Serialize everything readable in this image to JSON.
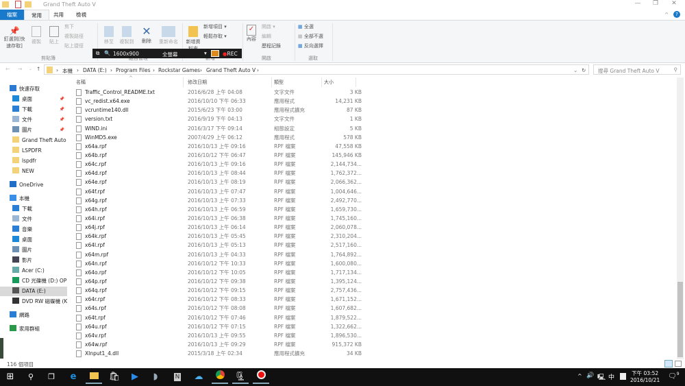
{
  "window": {
    "title": "Grand Theft Auto V",
    "minimize": "—",
    "maximize": "❐",
    "close": "✕"
  },
  "tabs": [
    {
      "label": "檔案"
    },
    {
      "label": "常用"
    },
    {
      "label": "共用"
    },
    {
      "label": "檢視"
    }
  ],
  "ribbon": {
    "clipboard": {
      "pin": "釘選到[快速存取]",
      "copy": "複製",
      "paste": "貼上",
      "cut": "剪下",
      "copy_path": "複製路徑",
      "paste_shortcut": "貼上捷徑",
      "group": "剪貼簿"
    },
    "organize": {
      "move_to": "移至",
      "copy_to": "複製到",
      "delete": "刪除",
      "rename": "重新命名",
      "group": "組合管理"
    },
    "new": {
      "new_folder": "新增資料夾",
      "new_item": "新增項目 ▾",
      "easy_access": "輕鬆存取 ▾",
      "group": "新增"
    },
    "open": {
      "properties": "內容",
      "open": "開啟 ▾",
      "edit": "編輯",
      "history": "歷程記錄",
      "group": "開啟"
    },
    "select": {
      "select_all": "全選",
      "select_none": "全部不選",
      "invert": "反向選擇",
      "group": "選取"
    }
  },
  "recorder": {
    "resolution": "1600x900",
    "mode": "全螢幕",
    "rec": "REC"
  },
  "address": {
    "crumbs": [
      "本機",
      "DATA (E:)",
      "Program Files",
      "Rockstar Games",
      "Grand Theft Auto V"
    ],
    "search_placeholder": "搜尋 Grand Theft Auto V"
  },
  "nav": [
    {
      "label": "快速存取",
      "color": "#2b79d0"
    },
    {
      "label": "桌面",
      "color": "#1e88d8",
      "pin": true
    },
    {
      "label": "下載",
      "color": "#2a7fd4",
      "pin": true
    },
    {
      "label": "文件",
      "color": "#9bb7d3",
      "pin": true
    },
    {
      "label": "圖片",
      "color": "#6d90b3",
      "pin": true
    },
    {
      "label": "Grand Theft Auto V",
      "color": "#f3d27a"
    },
    {
      "label": "LSPDFR",
      "color": "#f3d27a"
    },
    {
      "label": "lspdfr",
      "color": "#f3d27a"
    },
    {
      "label": "NEW",
      "color": "#f3d27a"
    },
    {
      "label": "OneDrive",
      "color": "#1f6fc9"
    },
    {
      "label": "本機",
      "color": "#3a8ee6"
    },
    {
      "label": "下載",
      "color": "#2a7fd4"
    },
    {
      "label": "文件",
      "color": "#9bb7d3"
    },
    {
      "label": "音樂",
      "color": "#2a7fd4"
    },
    {
      "label": "桌面",
      "color": "#1e88d8"
    },
    {
      "label": "圖片",
      "color": "#6d90b3"
    },
    {
      "label": "影片",
      "color": "#445"
    },
    {
      "label": "Acer (C:)",
      "color": "#6aa"
    },
    {
      "label": "CD 光碟機 (D:) OPE",
      "color": "#1a9a5a"
    },
    {
      "label": "DATA (E:)",
      "color": "#555",
      "selected": true
    },
    {
      "label": "DVD RW 磁碟機 (K",
      "color": "#333"
    },
    {
      "label": "網路",
      "color": "#2a7fd4"
    },
    {
      "label": "家用群組",
      "color": "#2a9a4a"
    }
  ],
  "columns": {
    "name": "名稱",
    "date": "修改日期",
    "type": "類型",
    "size": "大小"
  },
  "files": [
    [
      "Traffic_Control_README.txt",
      "2016/6/28 上午 04:08",
      "文字文件",
      "3 KB"
    ],
    [
      "vc_redist.x64.exe",
      "2016/10/10 下午 06:33",
      "應用程式",
      "14,231 KB"
    ],
    [
      "vcruntime140.dll",
      "2015/6/23 下午 03:00",
      "應用程式擴充",
      "87 KB"
    ],
    [
      "version.txt",
      "2016/9/19 下午 04:13",
      "文字文件",
      "1 KB"
    ],
    [
      "WIND.ini",
      "2016/3/17 下午 09:14",
      "組態設定",
      "5 KB"
    ],
    [
      "WinMD5.exe",
      "2007/4/29 上午 06:12",
      "應用程式",
      "578 KB"
    ],
    [
      "x64a.rpf",
      "2016/10/13 上午 09:16",
      "RPF 檔案",
      "47,558 KB"
    ],
    [
      "x64b.rpf",
      "2016/10/12 下午 06:47",
      "RPF 檔案",
      "145,946 KB"
    ],
    [
      "x64c.rpf",
      "2016/10/13 上午 09:16",
      "RPF 檔案",
      "2,144,734..."
    ],
    [
      "x64d.rpf",
      "2016/10/13 上午 08:44",
      "RPF 檔案",
      "1,762,372..."
    ],
    [
      "x64e.rpf",
      "2016/10/13 上午 08:19",
      "RPF 檔案",
      "2,066,362..."
    ],
    [
      "x64f.rpf",
      "2016/10/13 上午 07:47",
      "RPF 檔案",
      "1,004,646..."
    ],
    [
      "x64g.rpf",
      "2016/10/13 上午 07:33",
      "RPF 檔案",
      "2,492,770..."
    ],
    [
      "x64h.rpf",
      "2016/10/13 上午 06:59",
      "RPF 檔案",
      "1,659,730..."
    ],
    [
      "x64i.rpf",
      "2016/10/13 上午 06:38",
      "RPF 檔案",
      "1,745,160..."
    ],
    [
      "x64j.rpf",
      "2016/10/13 上午 06:14",
      "RPF 檔案",
      "2,060,078..."
    ],
    [
      "x64k.rpf",
      "2016/10/13 上午 05:45",
      "RPF 檔案",
      "2,310,204..."
    ],
    [
      "x64l.rpf",
      "2016/10/13 上午 05:13",
      "RPF 檔案",
      "2,517,160..."
    ],
    [
      "x64m.rpf",
      "2016/10/13 上午 04:33",
      "RPF 檔案",
      "1,764,892..."
    ],
    [
      "x64n.rpf",
      "2016/10/12 下午 10:33",
      "RPF 檔案",
      "1,600,080..."
    ],
    [
      "x64o.rpf",
      "2016/10/12 下午 10:05",
      "RPF 檔案",
      "1,717,134..."
    ],
    [
      "x64p.rpf",
      "2016/10/12 下午 09:38",
      "RPF 檔案",
      "1,395,124..."
    ],
    [
      "x64q.rpf",
      "2016/10/12 下午 09:15",
      "RPF 檔案",
      "2,757,436..."
    ],
    [
      "x64r.rpf",
      "2016/10/12 下午 08:33",
      "RPF 檔案",
      "1,671,152..."
    ],
    [
      "x64s.rpf",
      "2016/10/12 下午 08:08",
      "RPF 檔案",
      "1,607,682..."
    ],
    [
      "x64t.rpf",
      "2016/10/12 下午 07:46",
      "RPF 檔案",
      "1,879,522..."
    ],
    [
      "x64u.rpf",
      "2016/10/12 下午 07:15",
      "RPF 檔案",
      "1,322,662..."
    ],
    [
      "x64v.rpf",
      "2016/10/13 上午 09:55",
      "RPF 檔案",
      "1,896,530..."
    ],
    [
      "x64w.rpf",
      "2016/10/13 上午 09:29",
      "RPF 檔案",
      "915,372 KB"
    ],
    [
      "XInput1_4.dll",
      "2015/3/18 上午 02:34",
      "應用程式擴充",
      "34 KB"
    ]
  ],
  "status": {
    "count": "116 個項目"
  },
  "taskbar": {
    "ime": "中",
    "time": "下午 03:52",
    "date": "2016/10/21",
    "notifications": "9"
  },
  "colors": {
    "accent": "#1979ca",
    "taskbar": "#101010"
  }
}
